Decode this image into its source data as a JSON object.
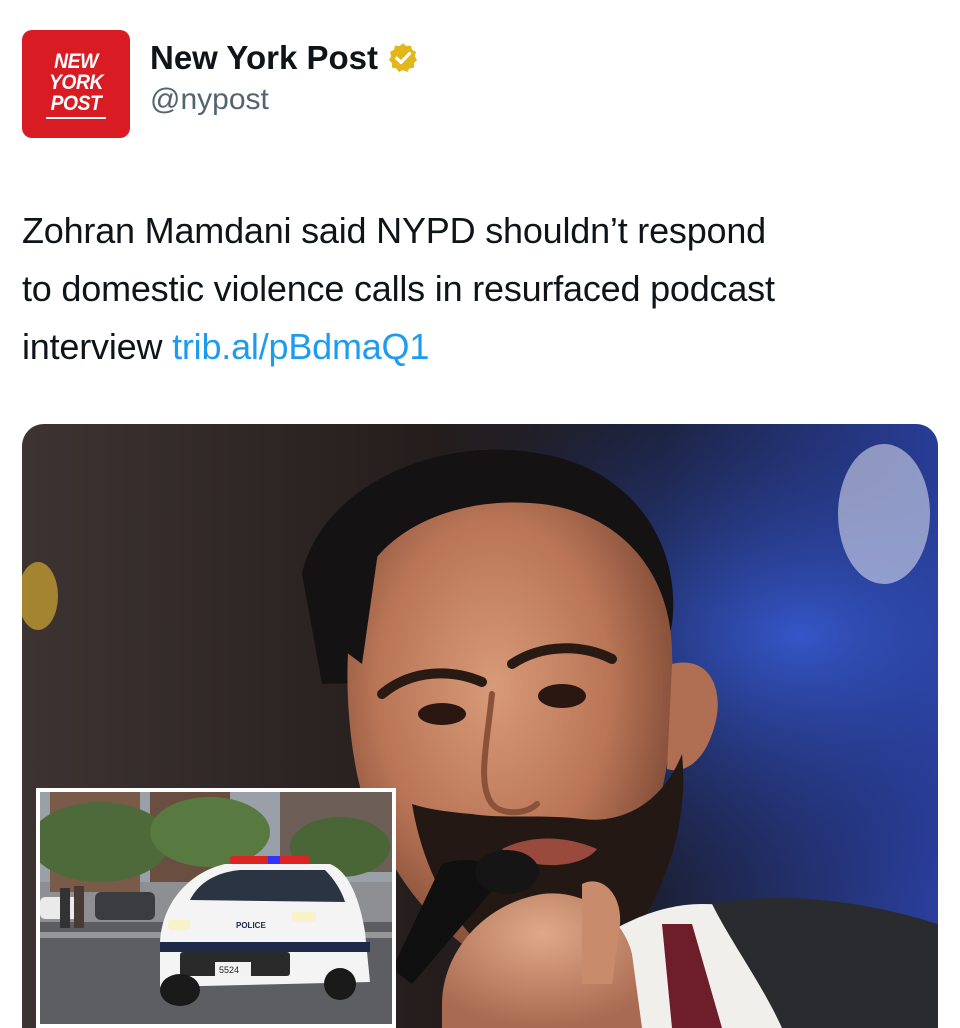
{
  "account": {
    "logo_lines": [
      "NEW",
      "YORK",
      "POST"
    ],
    "display_name": "New York Post",
    "handle": "@nypost",
    "verified_badge_icon": "verified-gold-badge-icon",
    "brand_color": "#d91c23",
    "badge_color": "#e2b719"
  },
  "tweet": {
    "text_lines": [
      "Zohran Mamdani said NYPD shouldn’t respond",
      "to domestic violence calls in resurfaced podcast",
      "interview "
    ],
    "link_text": "trib.al/pBdmaQ1",
    "link_color": "#1d9bf0"
  },
  "media": {
    "inset": {
      "police_label": "POLICE",
      "unit_number": "5524"
    }
  }
}
